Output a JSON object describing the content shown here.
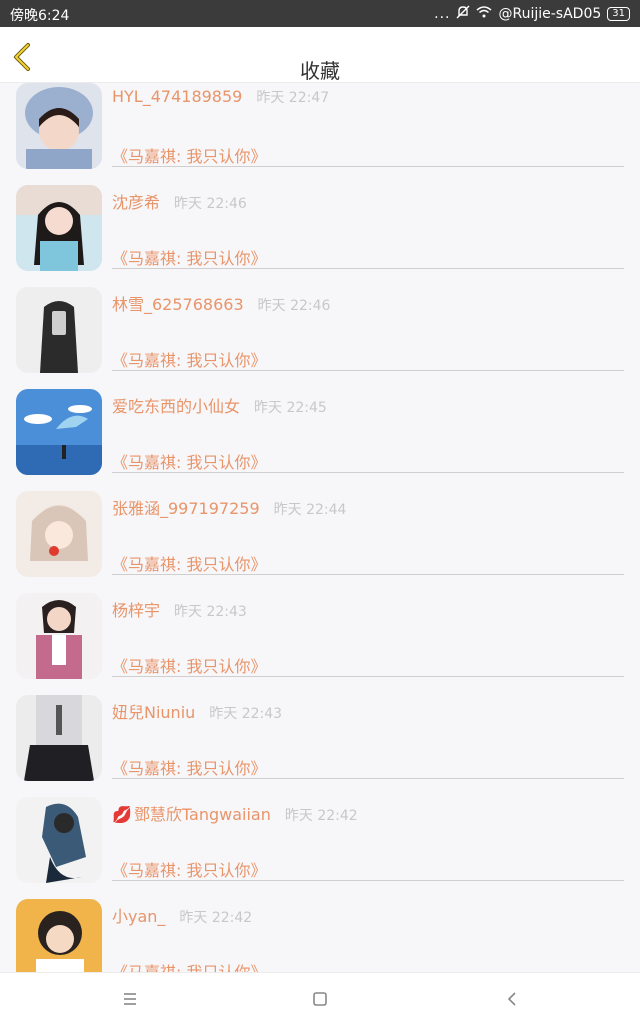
{
  "status_bar": {
    "time": "傍晚6:24",
    "dots": "...",
    "network": "@Ruijie-sAD05",
    "battery": "31"
  },
  "header": {
    "title": "收藏"
  },
  "items": [
    {
      "name": "HYL_474189859",
      "time": "昨天 22:47",
      "song": "《马嘉祺: 我只认你》",
      "has_lips": false
    },
    {
      "name": "沈彦希",
      "time": "昨天 22:46",
      "song": "《马嘉祺: 我只认你》",
      "has_lips": false
    },
    {
      "name": "林雪_625768663",
      "time": "昨天 22:46",
      "song": "《马嘉祺: 我只认你》",
      "has_lips": false
    },
    {
      "name": "爱吃东西的小仙女",
      "time": "昨天 22:45",
      "song": "《马嘉祺: 我只认你》",
      "has_lips": false
    },
    {
      "name": "张雅涵_997197259",
      "time": "昨天 22:44",
      "song": "《马嘉祺: 我只认你》",
      "has_lips": false
    },
    {
      "name": "杨梓宇",
      "time": "昨天 22:43",
      "song": "《马嘉祺: 我只认你》",
      "has_lips": false
    },
    {
      "name": "妞兒Niuniu",
      "time": "昨天 22:43",
      "song": "《马嘉祺: 我只认你》",
      "has_lips": false
    },
    {
      "name": "鄧慧欣Tangwaiian",
      "time": "昨天 22:42",
      "song": "《马嘉祺: 我只认你》",
      "has_lips": true
    },
    {
      "name": "小yan_",
      "time": "昨天 22:42",
      "song": "《马嘉祺: 我只认你》",
      "has_lips": false
    }
  ],
  "colors": {
    "accent": "#e8956a",
    "header_back": "#c9a800"
  },
  "nav": {
    "menu_icon": "menu-icon",
    "home_icon": "home-icon",
    "back_icon": "back-icon"
  }
}
